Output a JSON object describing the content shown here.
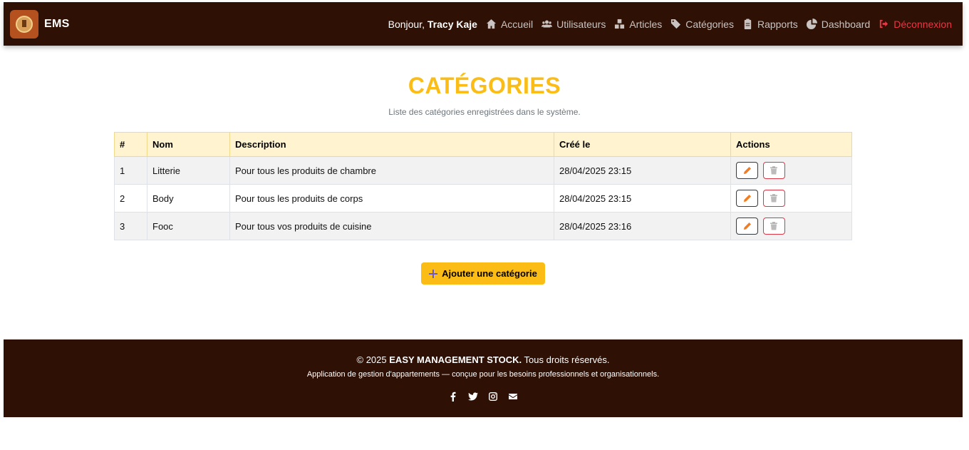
{
  "navbar": {
    "brand": "EMS",
    "greeting_prefix": "Bonjour,",
    "user_name": "Tracy Kaje",
    "links": [
      {
        "label": "Accueil",
        "icon": "home-icon"
      },
      {
        "label": "Utilisateurs",
        "icon": "users-icon"
      },
      {
        "label": "Articles",
        "icon": "boxes-icon"
      },
      {
        "label": "Catégories",
        "icon": "tags-icon"
      },
      {
        "label": "Rapports",
        "icon": "clipboard-icon"
      },
      {
        "label": "Dashboard",
        "icon": "pie-chart-icon"
      },
      {
        "label": "Déconnexion",
        "icon": "sign-out-icon"
      }
    ]
  },
  "page": {
    "title": "CATÉGORIES",
    "subtitle": "Liste des catégories enregistrées dans le système."
  },
  "table": {
    "headers": [
      "#",
      "Nom",
      "Description",
      "Créé le",
      "Actions"
    ],
    "rows": [
      {
        "num": "1",
        "nom": "Litterie",
        "description": "Pour tous les produits de chambre",
        "date": "28/04/2025 23:15"
      },
      {
        "num": "2",
        "nom": "Body",
        "description": "Pour tous les produits de corps",
        "date": "28/04/2025 23:15"
      },
      {
        "num": "3",
        "nom": "Fooc",
        "description": "Pour tous vos produits de cuisine",
        "date": "28/04/2025 23:16"
      }
    ]
  },
  "add_button": {
    "label": "Ajouter une catégorie",
    "icon": "plus-icon"
  },
  "footer": {
    "copyright_prefix": "© 2025",
    "company": "EASY MANAGEMENT STOCK.",
    "rights": "Tous droits réservés.",
    "tagline": "Application de gestion d'appartements — conçue pour les besoins professionnels et organisationnels.",
    "socials": [
      "facebook-icon",
      "twitter-icon",
      "instagram-icon",
      "envelope-icon"
    ]
  },
  "colors": {
    "navbar_bg": "#2f1004",
    "accent": "#fbbd15",
    "logout": "#e53945",
    "table_header_bg": "#fff4cf"
  }
}
